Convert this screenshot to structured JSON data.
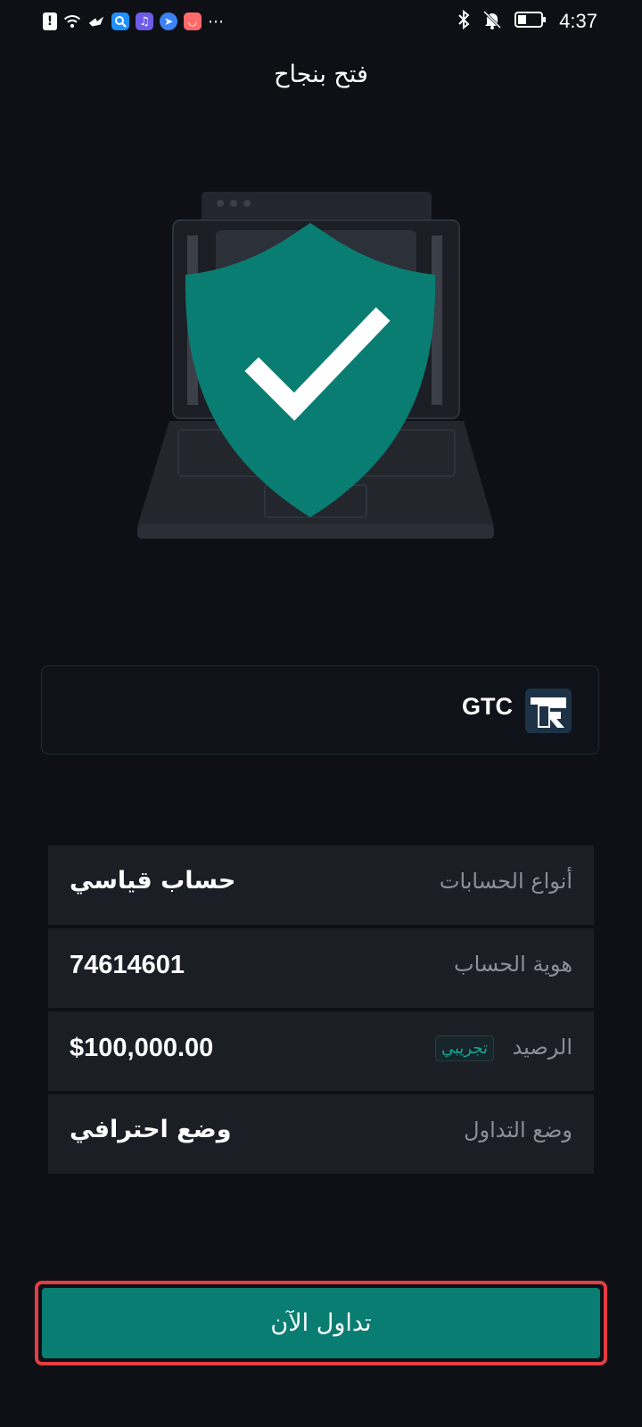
{
  "status_bar": {
    "time": "4:37",
    "icons_left": [
      "alert-icon",
      "wifi-icon",
      "bird-app-icon",
      "search-app-icon",
      "music-app-icon",
      "browser-app-icon",
      "shopping-app-icon",
      "more-dots-icon"
    ],
    "icons_right": [
      "bluetooth-icon",
      "mute-icon",
      "battery-icon"
    ]
  },
  "header": {
    "title": "فتح بنجاح"
  },
  "illustration": {
    "icon": "shield-check-icon",
    "color": "#0a7d72"
  },
  "broker": {
    "name": "GTC",
    "logo_icon": "gtc-logo-icon"
  },
  "account": {
    "rows": [
      {
        "label": "أنواع الحسابات",
        "value": "حساب قياسي"
      },
      {
        "label": "هوية الحساب",
        "value": "74614601"
      },
      {
        "label": "الرصيد",
        "value": "$100,000.00",
        "badge": "تجريبي"
      },
      {
        "label": "وضع التداول",
        "value": "وضع احترافي"
      }
    ]
  },
  "cta": {
    "label": "تداول الآن",
    "color": "#0a7d72",
    "highlight_color": "#e33d43"
  }
}
